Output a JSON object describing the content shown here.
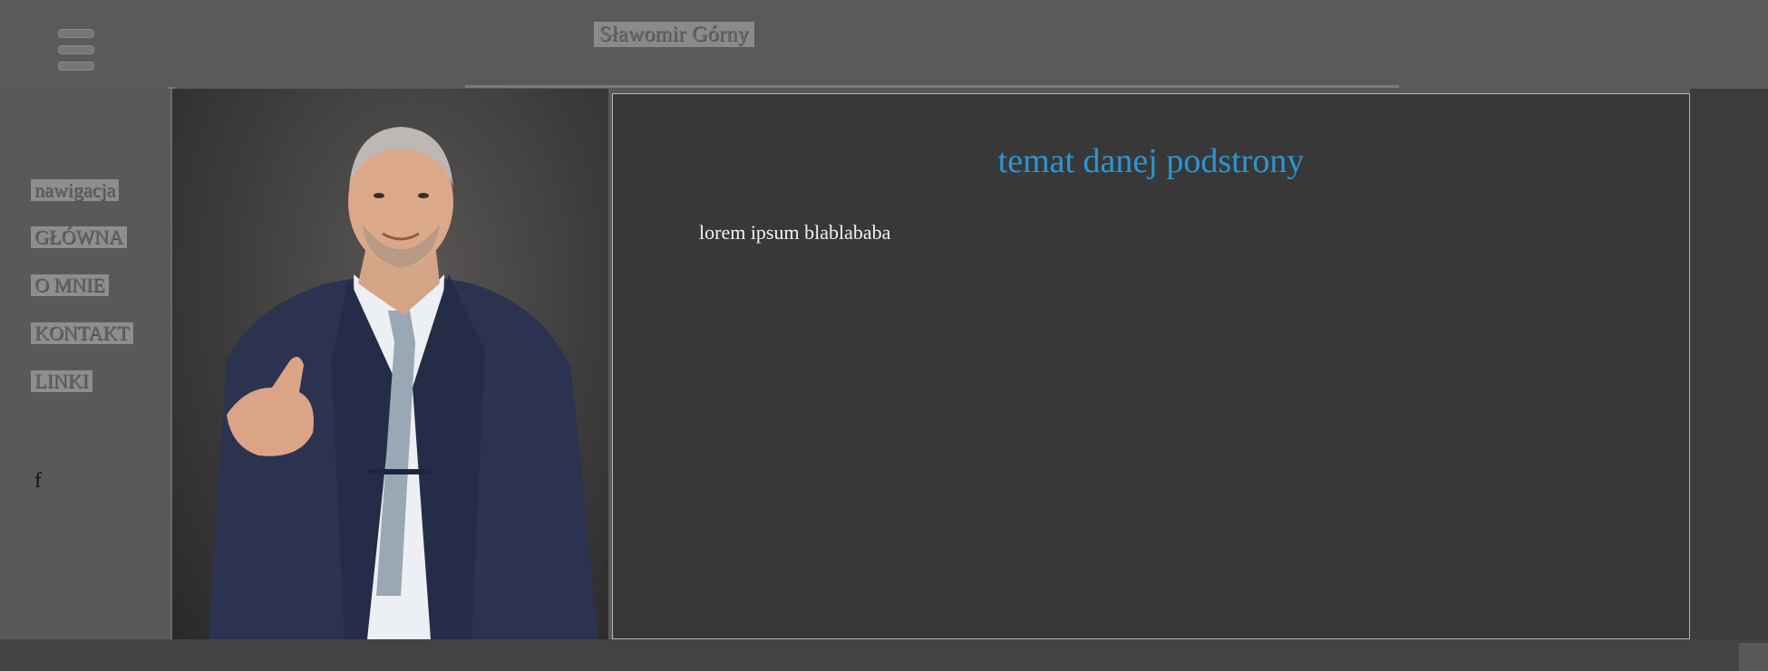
{
  "header": {
    "site_title": "Sławomir Górny",
    "menu_icon": "hamburger-menu-icon"
  },
  "sidebar": {
    "heading": "nawigacja",
    "items": [
      {
        "label": "GŁÓWNA"
      },
      {
        "label": "O MNIE"
      },
      {
        "label": "KONTAKT"
      },
      {
        "label": "LINKI"
      }
    ],
    "social_icon": "facebook-icon",
    "social_label": "f"
  },
  "photo": {
    "subject": "portrait-photo"
  },
  "main": {
    "heading": "temat danej podstrony",
    "body": "lorem ipsum blablababa"
  },
  "colors": {
    "background": "#595959",
    "content_bg": "#383838",
    "heading_blue": "#2a96d4",
    "footer": "#434343"
  }
}
